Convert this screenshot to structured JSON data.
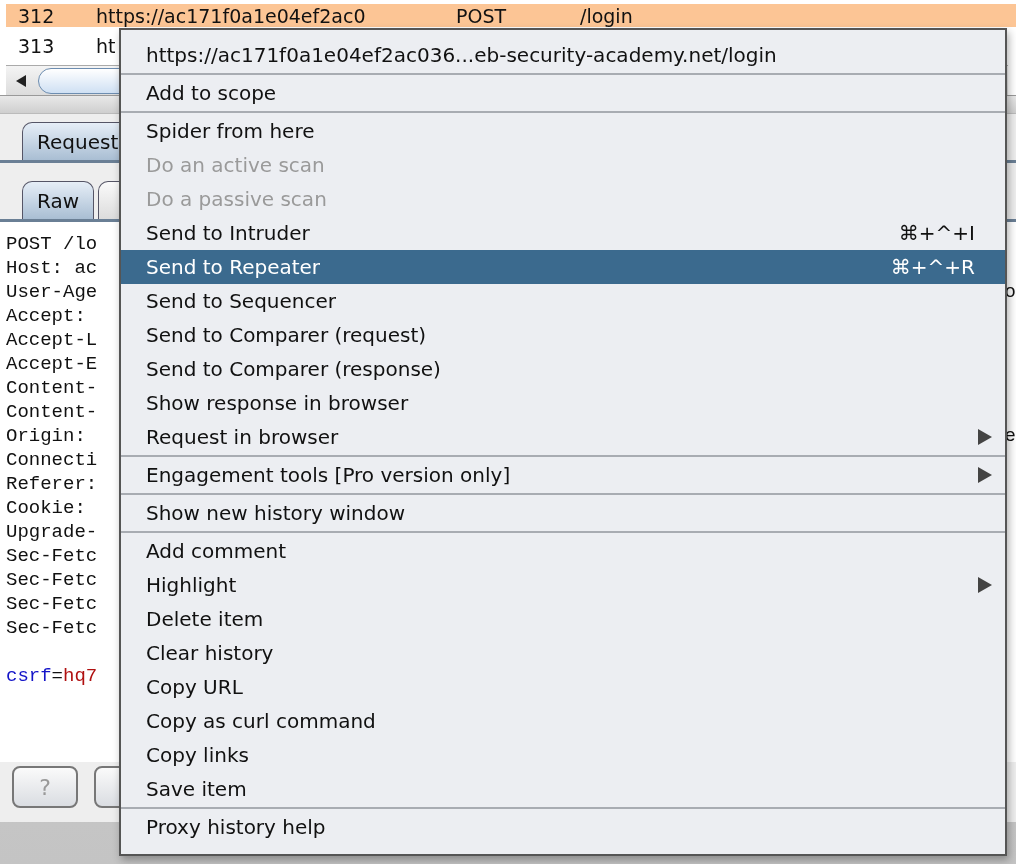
{
  "history_table": {
    "rows": [
      {
        "number": "312",
        "url": "https://ac171f0a1e04ef2ac0",
        "method": "POST",
        "path": "/login",
        "selected": true
      },
      {
        "number": "313",
        "url": "ht",
        "selected": false
      }
    ]
  },
  "tabs": [
    {
      "label": "Request",
      "selected": true
    }
  ],
  "subtabs": [
    {
      "label": "Raw",
      "selected": true
    },
    {
      "selected": false
    }
  ],
  "request_lines": [
    {
      "text": "POST /lo"
    },
    {
      "text": "Host: ac"
    },
    {
      "text": "User-Age",
      "tail": "o"
    },
    {
      "text": "Accept:"
    },
    {
      "text": "Accept-L"
    },
    {
      "text": "Accept-E"
    },
    {
      "text": "Content-"
    },
    {
      "text": "Content-"
    },
    {
      "text": "Origin:",
      "tail": "e"
    },
    {
      "text": "Connecti"
    },
    {
      "text": "Referer:"
    },
    {
      "text": "Cookie:"
    },
    {
      "text": "Upgrade-"
    },
    {
      "text": "Sec-Fetc"
    },
    {
      "text": "Sec-Fetc"
    },
    {
      "text": "Sec-Fetc"
    },
    {
      "text": "Sec-Fetc"
    }
  ],
  "body_param": {
    "name": "csrf",
    "equals": "=",
    "value": "hq7"
  },
  "buttons": [
    {
      "kind": "help",
      "label": "?"
    },
    {
      "kind": "plain"
    }
  ],
  "context_menu": {
    "groups": [
      [
        {
          "label": "https://ac171f0a1e04ef2ac036...eb-security-academy.net/login",
          "disabled": false,
          "selected": false
        }
      ],
      [
        {
          "label": "Add to scope",
          "disabled": false,
          "selected": false
        }
      ],
      [
        {
          "label": "Spider from here",
          "disabled": false,
          "selected": false
        },
        {
          "label": "Do an active scan",
          "disabled": true,
          "selected": false
        },
        {
          "label": "Do a passive scan",
          "disabled": true,
          "selected": false
        },
        {
          "label": "Send to Intruder",
          "disabled": false,
          "selected": false,
          "shortcut": "⌘+^+I"
        },
        {
          "label": "Send to Repeater",
          "disabled": false,
          "selected": true,
          "shortcut": "⌘+^+R"
        },
        {
          "label": "Send to Sequencer",
          "disabled": false,
          "selected": false
        },
        {
          "label": "Send to Comparer (request)",
          "disabled": false,
          "selected": false
        },
        {
          "label": "Send to Comparer (response)",
          "disabled": false,
          "selected": false
        },
        {
          "label": "Show response in browser",
          "disabled": false,
          "selected": false
        },
        {
          "label": "Request in browser",
          "disabled": false,
          "selected": false,
          "submenu": true
        }
      ],
      [
        {
          "label": "Engagement tools [Pro version only]",
          "disabled": false,
          "selected": false,
          "submenu": true
        }
      ],
      [
        {
          "label": "Show new history window",
          "disabled": false,
          "selected": false
        }
      ],
      [
        {
          "label": "Add comment",
          "disabled": false,
          "selected": false
        },
        {
          "label": "Highlight",
          "disabled": false,
          "selected": false,
          "submenu": true
        },
        {
          "label": "Delete item",
          "disabled": false,
          "selected": false
        },
        {
          "label": "Clear history",
          "disabled": false,
          "selected": false
        },
        {
          "label": "Copy URL",
          "disabled": false,
          "selected": false
        },
        {
          "label": "Copy as curl command",
          "disabled": false,
          "selected": false
        },
        {
          "label": "Copy links",
          "disabled": false,
          "selected": false
        },
        {
          "label": "Save item",
          "disabled": false,
          "selected": false
        }
      ],
      [
        {
          "label": "Proxy history help",
          "disabled": false,
          "selected": false
        }
      ]
    ]
  }
}
